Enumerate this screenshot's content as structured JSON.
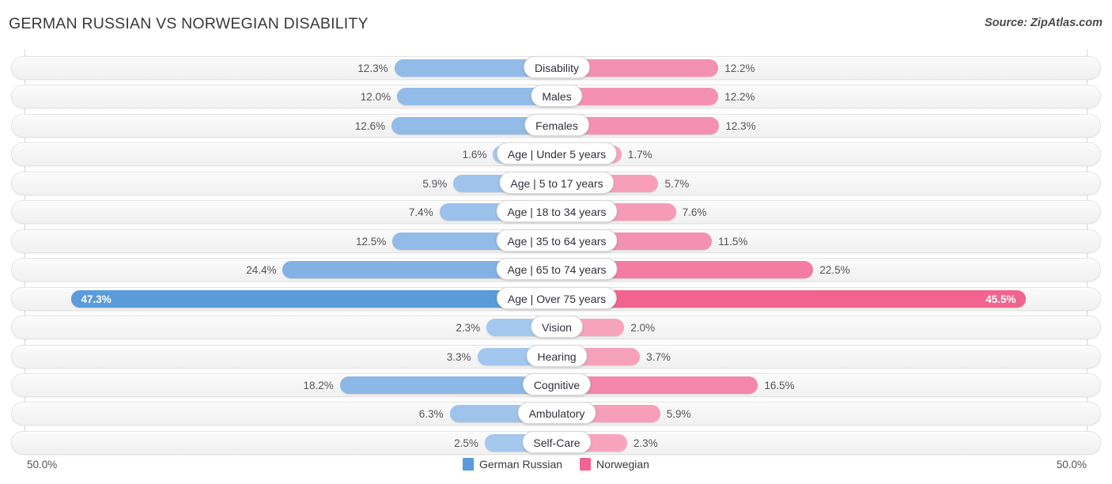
{
  "header": {
    "title": "GERMAN RUSSIAN VS NORWEGIAN DISABILITY",
    "source": "Source: ZipAtlas.com"
  },
  "axis": {
    "left_label": "50.0%",
    "right_label": "50.0%",
    "max": 50.0
  },
  "legend": {
    "items": [
      {
        "label": "German Russian",
        "color": "#5a9bdc"
      },
      {
        "label": "Norwegian",
        "color": "#f2638f"
      }
    ]
  },
  "colors": {
    "blue_light": "#92bbe8",
    "blue_mid": "#84b3e5",
    "blue_dark": "#5a9bdc",
    "pink_light": "#f490b1",
    "pink_mid": "#f37fa5",
    "pink_dark": "#f2638f",
    "row_background": "#f6f6f6",
    "row_border": "#e3e3e3",
    "axis_line": "#d6d6d6",
    "text": "#54545a"
  },
  "chart_data": {
    "type": "bar",
    "orientation": "horizontal-diverging",
    "title": "GERMAN RUSSIAN VS NORWEGIAN DISABILITY",
    "xlabel": "",
    "ylabel": "",
    "xlim": [
      50.0,
      50.0
    ],
    "grid": false,
    "legend_position": "bottom-center",
    "categories": [
      "Disability",
      "Males",
      "Females",
      "Age | Under 5 years",
      "Age | 5 to 17 years",
      "Age | 18 to 34 years",
      "Age | 35 to 64 years",
      "Age | 65 to 74 years",
      "Age | Over 75 years",
      "Vision",
      "Hearing",
      "Cognitive",
      "Ambulatory",
      "Self-Care"
    ],
    "series": [
      {
        "name": "German Russian",
        "values": [
          12.3,
          12.0,
          12.6,
          1.6,
          5.9,
          7.4,
          12.5,
          24.4,
          47.3,
          2.3,
          3.3,
          18.2,
          6.3,
          2.5
        ],
        "labels": [
          "12.3%",
          "12.0%",
          "12.6%",
          "1.6%",
          "5.9%",
          "7.4%",
          "12.5%",
          "24.4%",
          "47.3%",
          "2.3%",
          "3.3%",
          "18.2%",
          "6.3%",
          "2.5%"
        ]
      },
      {
        "name": "Norwegian",
        "values": [
          12.2,
          12.2,
          12.3,
          1.7,
          5.7,
          7.6,
          11.5,
          22.5,
          45.5,
          2.0,
          3.7,
          16.5,
          5.9,
          2.3
        ],
        "labels": [
          "12.2%",
          "12.2%",
          "12.3%",
          "1.7%",
          "5.7%",
          "7.6%",
          "11.5%",
          "22.5%",
          "45.5%",
          "2.0%",
          "3.7%",
          "16.5%",
          "5.9%",
          "2.3%"
        ]
      }
    ]
  },
  "rows": [
    {
      "label": "Disability",
      "left_value": "12.3%",
      "right_value": "12.2%",
      "left_num": 12.3,
      "right_num": 12.2,
      "left_color": "#92bbe8",
      "right_color": "#f490b1",
      "inside": false
    },
    {
      "label": "Males",
      "left_value": "12.0%",
      "right_value": "12.2%",
      "left_num": 12.0,
      "right_num": 12.2,
      "left_color": "#92bbe8",
      "right_color": "#f490b1",
      "inside": false
    },
    {
      "label": "Females",
      "left_value": "12.6%",
      "right_value": "12.3%",
      "left_num": 12.6,
      "right_num": 12.3,
      "left_color": "#92bbe8",
      "right_color": "#f490b1",
      "inside": false
    },
    {
      "label": "Age | Under 5 years",
      "left_value": "1.6%",
      "right_value": "1.7%",
      "left_num": 1.6,
      "right_num": 1.7,
      "left_color": "#a6c9ee",
      "right_color": "#f7a5bf",
      "inside": false
    },
    {
      "label": "Age | 5 to 17 years",
      "left_value": "5.9%",
      "right_value": "5.7%",
      "left_num": 5.9,
      "right_num": 5.7,
      "left_color": "#9fc4ec",
      "right_color": "#f69eba",
      "inside": false
    },
    {
      "label": "Age | 18 to 34 years",
      "left_value": "7.4%",
      "right_value": "7.6%",
      "left_num": 7.4,
      "right_num": 7.6,
      "left_color": "#9cc2eb",
      "right_color": "#f59ab7",
      "inside": false
    },
    {
      "label": "Age | 35 to 64 years",
      "left_value": "12.5%",
      "right_value": "11.5%",
      "left_num": 12.5,
      "right_num": 11.5,
      "left_color": "#92bbe8",
      "right_color": "#f490b1",
      "inside": false
    },
    {
      "label": "Age | 65 to 74 years",
      "left_value": "24.4%",
      "right_value": "22.5%",
      "left_num": 24.4,
      "right_num": 22.5,
      "left_color": "#82b2e4",
      "right_color": "#f47ba2",
      "inside": false
    },
    {
      "label": "Age | Over 75 years",
      "left_value": "47.3%",
      "right_value": "45.5%",
      "left_num": 47.3,
      "right_num": 45.5,
      "left_color": "#5a9bdc",
      "right_color": "#f2638f",
      "inside": true
    },
    {
      "label": "Vision",
      "left_value": "2.3%",
      "right_value": "2.0%",
      "left_num": 2.3,
      "right_num": 2.0,
      "left_color": "#a4c8ee",
      "right_color": "#f7a3be",
      "inside": false
    },
    {
      "label": "Hearing",
      "left_value": "3.3%",
      "right_value": "3.7%",
      "left_num": 3.3,
      "right_num": 3.7,
      "left_color": "#a2c6ed",
      "right_color": "#f6a1bc",
      "inside": false
    },
    {
      "label": "Cognitive",
      "left_value": "18.2%",
      "right_value": "16.5%",
      "left_num": 18.2,
      "right_num": 16.5,
      "left_color": "#8cb8e7",
      "right_color": "#f486ab",
      "inside": false
    },
    {
      "label": "Ambulatory",
      "left_value": "6.3%",
      "right_value": "5.9%",
      "left_num": 6.3,
      "right_num": 5.9,
      "left_color": "#9fc4ec",
      "right_color": "#f69eba",
      "inside": false
    },
    {
      "label": "Self-Care",
      "left_value": "2.5%",
      "right_value": "2.3%",
      "left_num": 2.5,
      "right_num": 2.3,
      "left_color": "#a4c8ee",
      "right_color": "#f7a3be",
      "inside": false
    }
  ]
}
